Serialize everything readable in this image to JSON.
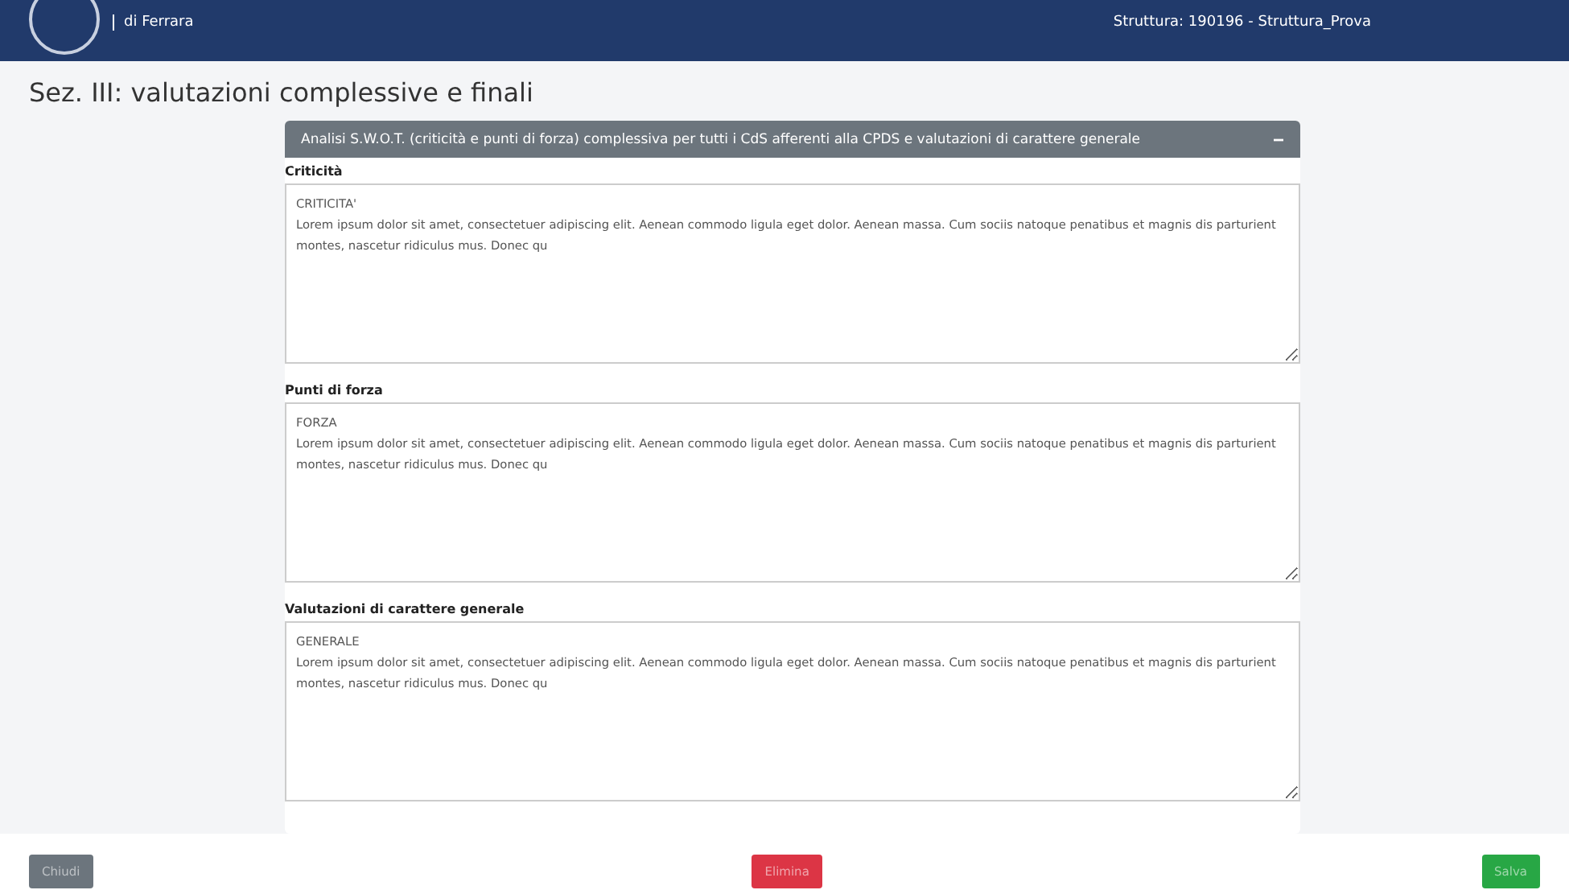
{
  "header": {
    "institution": "di Ferrara",
    "structure": "Struttura: 190196 - Struttura_Prova"
  },
  "page_title": "Sez. III: valutazioni complessive e finali",
  "panel": {
    "title": "Analisi S.W.O.T. (criticità e punti di forza) complessiva per tutti i CdS afferenti alla CPDS e valutazioni di carattere generale",
    "toggle": "−",
    "sections": [
      {
        "label": "Criticità",
        "value": "CRITICITA'\nLorem ipsum dolor sit amet, consectetuer adipiscing elit. Aenean commodo ligula eget dolor. Aenean massa. Cum sociis natoque penatibus et magnis dis parturient montes, nascetur ridiculus mus. Donec qu"
      },
      {
        "label": "Punti di forza",
        "value": "FORZA\nLorem ipsum dolor sit amet, consectetuer adipiscing elit. Aenean commodo ligula eget dolor. Aenean massa. Cum sociis natoque penatibus et magnis dis parturient montes, nascetur ridiculus mus. Donec qu"
      },
      {
        "label": "Valutazioni di carattere generale",
        "value": "GENERALE\nLorem ipsum dolor sit amet, consectetuer adipiscing elit. Aenean commodo ligula eget dolor. Aenean massa. Cum sociis natoque penatibus et magnis dis parturient montes, nascetur ridiculus mus. Donec qu"
      }
    ]
  },
  "buttons": [
    {
      "label": "Chiudi",
      "kind": "secondary"
    },
    {
      "label": "Elimina",
      "kind": "danger"
    },
    {
      "label": "Salva",
      "kind": "success"
    }
  ]
}
